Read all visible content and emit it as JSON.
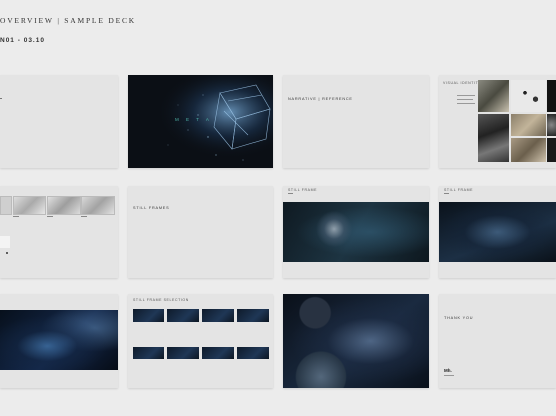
{
  "header": {
    "title": "OVERVIEW | SAMPLE DECK",
    "subtitle": "N01 - 03.10"
  },
  "slides": {
    "s2_word": "M E T A",
    "s3_title": "NARRATIVE | REFERENCE",
    "s4_caption": "VISUAL IDENTITY",
    "s6_title": "STILL FRAMES",
    "s7_caption": "STILL FRAME",
    "s8_caption": "STILL FRAME",
    "s10_caption": "STILL FRAME SELECTION",
    "s12_title": "THANK YOU",
    "s12_logo": "Mh."
  },
  "colors": {
    "page_bg": "#ececec",
    "slide_bg": "#e4e4e4",
    "accent_teal": "#4fb3a6"
  }
}
